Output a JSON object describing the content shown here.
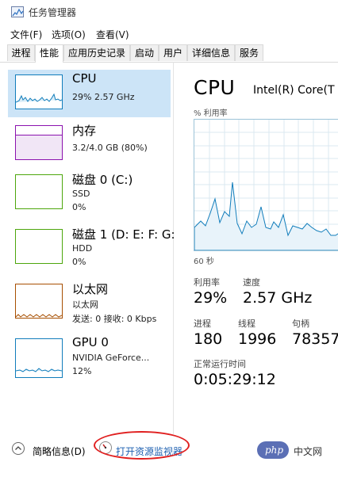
{
  "window": {
    "title": "任务管理器"
  },
  "menu": [
    "文件(F)",
    "选项(O)",
    "查看(V)"
  ],
  "tabs": [
    "进程",
    "性能",
    "应用历史记录",
    "启动",
    "用户",
    "详细信息",
    "服务"
  ],
  "active_tab": "性能",
  "sidebar": {
    "items": [
      {
        "name": "CPU",
        "line1": "29% 2.57 GHz",
        "line2": ""
      },
      {
        "name": "内存",
        "line1": "3.2/4.0 GB (80%)",
        "line2": ""
      },
      {
        "name": "磁盘 0 (C:)",
        "line1": "SSD",
        "line2": "0%"
      },
      {
        "name": "磁盘 1 (D: E: F: G:",
        "line1": "HDD",
        "line2": "0%"
      },
      {
        "name": "以太网",
        "line1": "以太网",
        "line2": "发送: 0 接收: 0 Kbps"
      },
      {
        "name": "GPU 0",
        "line1": "NVIDIA GeForce...",
        "line2": "12%"
      }
    ]
  },
  "detail": {
    "title": "CPU",
    "model": "Intel(R) Core(T",
    "util_label": "% 利用率",
    "time_label": "60 秒",
    "stats": {
      "utilization": {
        "label": "利用率",
        "value": "29%"
      },
      "speed": {
        "label": "速度",
        "value": "2.57 GHz"
      },
      "processes": {
        "label": "进程",
        "value": "180"
      },
      "threads": {
        "label": "线程",
        "value": "1996"
      },
      "handles": {
        "label": "句柄",
        "value": "78357"
      },
      "uptime": {
        "label": "正常运行时间",
        "value": "0:05:29:12"
      }
    }
  },
  "footer": {
    "less_details": "简略信息(D)",
    "resource_monitor": "打开资源监视器"
  },
  "watermark": {
    "badge": "php",
    "text": "中文网"
  },
  "colors": {
    "cpu_border": "#117dbb",
    "memory_border": "#8b12ae",
    "disk_border": "#4da60c",
    "ethernet_border": "#a74f01",
    "selection": "#cce4f7",
    "annotation_red": "#e02020"
  }
}
